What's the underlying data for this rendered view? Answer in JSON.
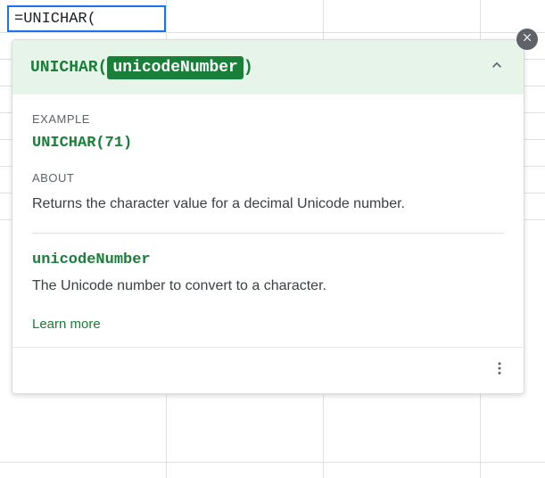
{
  "formula_cell": {
    "value": "=UNICHAR("
  },
  "help_panel": {
    "signature": {
      "func_name": "UNICHAR",
      "open_paren": "(",
      "param": "unicodeNumber",
      "close_paren": ")"
    },
    "example": {
      "label": "EXAMPLE",
      "text": "UNICHAR(71)"
    },
    "about": {
      "label": "ABOUT",
      "text": "Returns the character value for a decimal Unicode number."
    },
    "param": {
      "name": "unicodeNumber",
      "description": "The Unicode number to convert to a character."
    },
    "learn_more": "Learn more"
  }
}
